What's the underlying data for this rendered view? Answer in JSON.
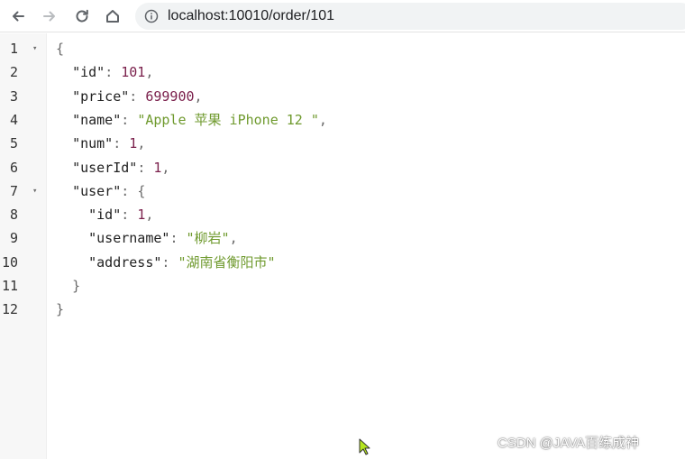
{
  "browser": {
    "url": "localhost:10010/order/101",
    "nav_icons": [
      "back-arrow-icon",
      "forward-arrow-icon",
      "reload-icon",
      "home-icon"
    ],
    "site_info_icon": "info-icon"
  },
  "code": {
    "line_numbers": [
      "1",
      "2",
      "3",
      "4",
      "5",
      "6",
      "7",
      "8",
      "9",
      "10",
      "11",
      "12"
    ],
    "foldable_lines": [
      "1",
      "7"
    ],
    "lines": [
      {
        "indent": "",
        "key": "",
        "value": "",
        "punct": "{"
      },
      {
        "indent": "  ",
        "key": "\"id\"",
        "sep": ": ",
        "value": "101",
        "vtype": "num",
        "punct": ","
      },
      {
        "indent": "  ",
        "key": "\"price\"",
        "sep": ": ",
        "value": "699900",
        "vtype": "num",
        "punct": ","
      },
      {
        "indent": "  ",
        "key": "\"name\"",
        "sep": ": ",
        "value": "\"Apple 苹果 iPhone 12 \"",
        "vtype": "str",
        "punct": ","
      },
      {
        "indent": "  ",
        "key": "\"num\"",
        "sep": ": ",
        "value": "1",
        "vtype": "num",
        "punct": ","
      },
      {
        "indent": "  ",
        "key": "\"userId\"",
        "sep": ": ",
        "value": "1",
        "vtype": "num",
        "punct": ","
      },
      {
        "indent": "  ",
        "key": "\"user\"",
        "sep": ": ",
        "value": "",
        "vtype": "",
        "punct": "{"
      },
      {
        "indent": "    ",
        "key": "\"id\"",
        "sep": ": ",
        "value": "1",
        "vtype": "num",
        "punct": ","
      },
      {
        "indent": "    ",
        "key": "\"username\"",
        "sep": ": ",
        "value": "\"柳岩\"",
        "vtype": "str",
        "punct": ","
      },
      {
        "indent": "    ",
        "key": "\"address\"",
        "sep": ": ",
        "value": "\"湖南省衡阳市\"",
        "vtype": "str",
        "punct": ""
      },
      {
        "indent": "  ",
        "key": "",
        "value": "",
        "punct": "}"
      },
      {
        "indent": "",
        "key": "",
        "value": "",
        "punct": "}"
      }
    ]
  },
  "watermark": "CSDN @JAVA百练成神",
  "colors": {
    "number": "#7a1f4b",
    "string": "#6f9a2e",
    "key": "#222222",
    "gutter_bg": "#f7f7f7"
  }
}
